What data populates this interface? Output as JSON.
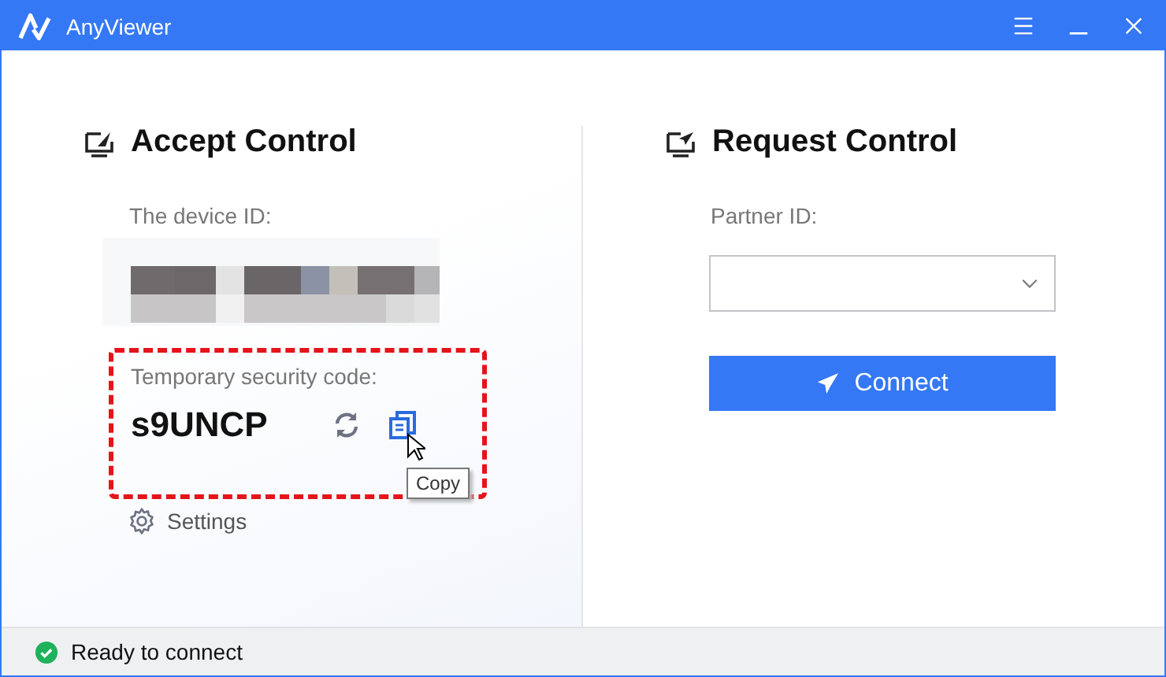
{
  "window": {
    "title": "AnyViewer"
  },
  "accept": {
    "title": "Accept Control",
    "device_label": "The device ID:",
    "code_label": "Temporary security code:",
    "code": "s9UNCP",
    "tooltip": "Copy",
    "settings": "Settings"
  },
  "request": {
    "title": "Request Control",
    "partner_label": "Partner ID:",
    "button": "Connect"
  },
  "status_bar": {
    "text": "Ready to connect"
  }
}
